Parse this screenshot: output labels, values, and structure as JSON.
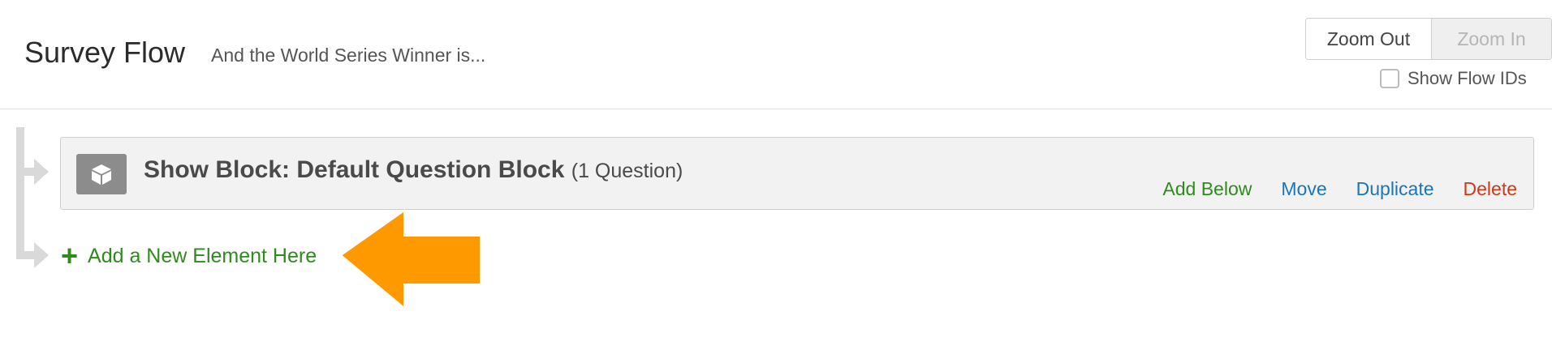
{
  "header": {
    "title": "Survey Flow",
    "survey_name": "And the World Series Winner is...",
    "zoom_out_label": "Zoom Out",
    "zoom_in_label": "Zoom In",
    "show_flow_ids_label": "Show Flow IDs",
    "show_flow_ids_checked": false
  },
  "block": {
    "title": "Show Block: Default Question Block",
    "count": "(1 Question)",
    "icon": "cube-icon",
    "actions": {
      "add_below": "Add Below",
      "move": "Move",
      "duplicate": "Duplicate",
      "delete": "Delete"
    }
  },
  "add_element": {
    "label": "Add a New Element Here",
    "icon": "plus-icon"
  },
  "colors": {
    "green": "#2e8b1e",
    "blue": "#1a75bb",
    "red": "#cc3a1a",
    "callout_orange": "#ff9900"
  }
}
